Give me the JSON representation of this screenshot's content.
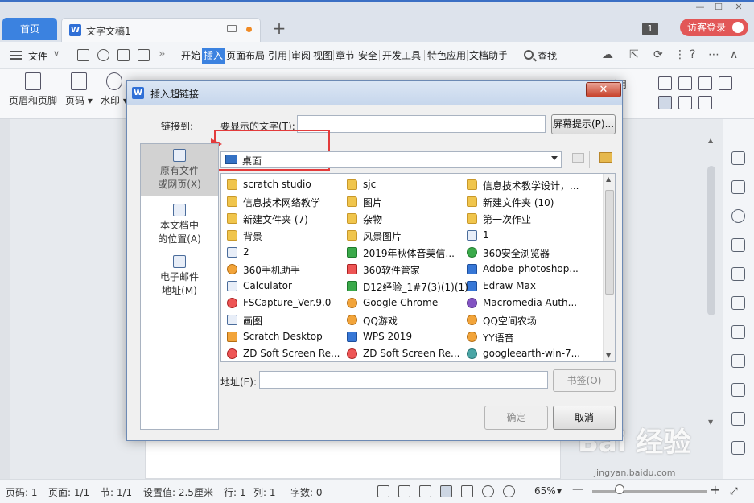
{
  "app": {
    "tabs": {
      "home": "首页",
      "document": "文字文稿1"
    },
    "badge_count": "1",
    "login_button": "访客登录"
  },
  "menu": {
    "file": "文件",
    "tabs": [
      "开始",
      "插入",
      "页面布局",
      "引用",
      "审阅",
      "视图",
      "章节",
      "安全",
      "开发工具",
      "特色应用",
      "文档助手"
    ],
    "active_tab": "插入",
    "search": "查找"
  },
  "ribbon": {
    "header_footer": "页眉和页脚",
    "page_number": "页码",
    "watermark": "水印",
    "cross_ref_partial": "叉引用"
  },
  "status": {
    "page_no": "页码: 1",
    "page_count": "页面: 1/1",
    "section": "节: 1/1",
    "setting": "设置值: 2.5厘米",
    "row": "行: 1",
    "col": "列: 1",
    "word_count": "字数: 0",
    "zoom": "65%",
    "zoom_fraction": 0.24
  },
  "watermark": {
    "logo": "Bai 经验",
    "url": "jingyan.baidu.com"
  },
  "dialog": {
    "title": "插入超链接",
    "close": "✕",
    "link_to_label": "链接到:",
    "display_text_label": "要显示的文字(T):",
    "display_text_value": "",
    "screentip_button": "屏幕提示(P)...",
    "nav": [
      {
        "line1": "原有文件",
        "line2": "或网页(X)",
        "selected": true
      },
      {
        "line1": "本文档中",
        "line2": "的位置(A)",
        "selected": false
      },
      {
        "line1": "电子邮件",
        "line2": "地址(M)",
        "selected": false
      }
    ],
    "location": "桌面",
    "files": [
      {
        "name": "scratch studio",
        "type": "folder"
      },
      {
        "name": "sjc",
        "type": "folder"
      },
      {
        "name": "信息技术教学设计，...",
        "type": "folder"
      },
      {
        "name": "信息技术网络教学",
        "type": "folder"
      },
      {
        "name": "图片",
        "type": "folder"
      },
      {
        "name": "新建文件夹 (10)",
        "type": "folder"
      },
      {
        "name": "新建文件夹 (7)",
        "type": "folder"
      },
      {
        "name": "杂物",
        "type": "folder"
      },
      {
        "name": "第一次作业",
        "type": "folder"
      },
      {
        "name": "背景",
        "type": "folder"
      },
      {
        "name": "风景图片",
        "type": "folder"
      },
      {
        "name": "1",
        "type": "app"
      },
      {
        "name": "2",
        "type": "app"
      },
      {
        "name": "2019年秋体音美信...",
        "type": "green"
      },
      {
        "name": "360安全浏览器",
        "type": "green round"
      },
      {
        "name": "360手机助手",
        "type": "orange round"
      },
      {
        "name": "360软件管家",
        "type": "red"
      },
      {
        "name": "Adobe_photoshop...",
        "type": "blue"
      },
      {
        "name": "Calculator",
        "type": "app"
      },
      {
        "name": "D12经验_1#7(3)(1)(1)",
        "type": "green"
      },
      {
        "name": "Edraw Max",
        "type": "blue"
      },
      {
        "name": "FSCapture_Ver.9.0",
        "type": "red round"
      },
      {
        "name": "Google Chrome",
        "type": "orange round"
      },
      {
        "name": "Macromedia Auth...",
        "type": "purple round"
      },
      {
        "name": "画图",
        "type": "app"
      },
      {
        "name": "QQ游戏",
        "type": "orange round"
      },
      {
        "name": "QQ空间农场",
        "type": "orange round"
      },
      {
        "name": "Scratch Desktop",
        "type": "orange"
      },
      {
        "name": "WPS 2019",
        "type": "blue"
      },
      {
        "name": "YY语音",
        "type": "orange round"
      },
      {
        "name": "ZD Soft Screen Re...",
        "type": "red round"
      },
      {
        "name": "ZD Soft Screen Re...",
        "type": "red round"
      },
      {
        "name": "googleearth-win-7...",
        "type": "teal round"
      }
    ],
    "address_label": "地址(E):",
    "address_value": "",
    "bookmark_button": "书签(O)",
    "ok_button": "确定",
    "cancel_button": "取消"
  }
}
